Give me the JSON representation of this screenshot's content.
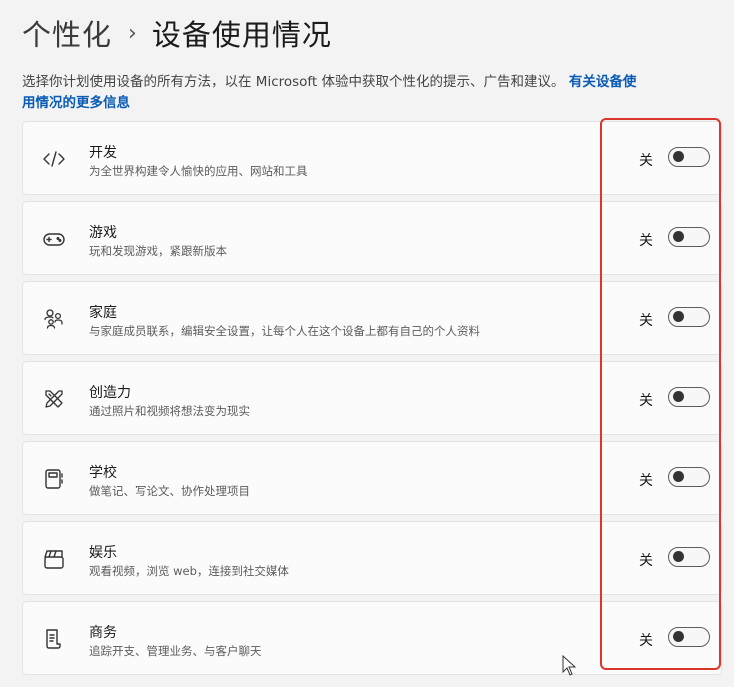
{
  "header": {
    "parent": "个性化",
    "separator": "›",
    "current": "设备使用情况"
  },
  "description": {
    "text": "选择你计划使用设备的所有方法，以在 Microsoft 体验中获取个性化的提示、广告和建议。",
    "link_line1": "有关设备使",
    "link_line2": "用情况的更多信息"
  },
  "items": [
    {
      "icon": "code-icon",
      "title": "开发",
      "subtitle": "为全世界构建令人愉快的应用、网站和工具",
      "state": "关",
      "on": false
    },
    {
      "icon": "gamepad-icon",
      "title": "游戏",
      "subtitle": "玩和发现游戏，紧跟新版本",
      "state": "关",
      "on": false
    },
    {
      "icon": "family-icon",
      "title": "家庭",
      "subtitle": "与家庭成员联系，编辑安全设置，让每个人在这个设备上都有自己的个人资料",
      "state": "关",
      "on": false
    },
    {
      "icon": "design-tools-icon",
      "title": "创造力",
      "subtitle": "通过照片和视频将想法变为现实",
      "state": "关",
      "on": false
    },
    {
      "icon": "notebook-icon",
      "title": "学校",
      "subtitle": "做笔记、写论文、协作处理项目",
      "state": "关",
      "on": false
    },
    {
      "icon": "clapperboard-icon",
      "title": "娱乐",
      "subtitle": "观看视频，浏览 web，连接到社交媒体",
      "state": "关",
      "on": false
    },
    {
      "icon": "document-icon",
      "title": "商务",
      "subtitle": "追踪开支、管理业务、与客户聊天",
      "state": "关",
      "on": false
    }
  ],
  "colors": {
    "link": "#0a5bb5",
    "highlight_box": "#d9372b",
    "toggle_off_border": "#5d5d5d"
  }
}
